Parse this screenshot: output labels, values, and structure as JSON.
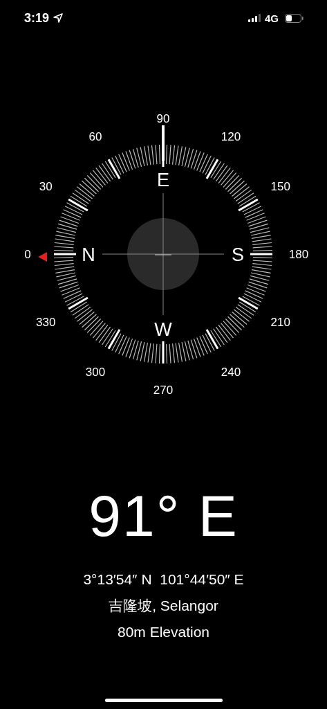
{
  "status_bar": {
    "time": "3:19",
    "network": "4G"
  },
  "dial": {
    "degree_labels": [
      "0",
      "30",
      "60",
      "90",
      "120",
      "150",
      "180",
      "210",
      "240",
      "270",
      "300",
      "330"
    ],
    "cardinals": [
      "N",
      "E",
      "S",
      "W"
    ]
  },
  "heading": "91° E",
  "coordinates": "3°13′54″ N  101°44′50″ E",
  "location": "吉隆坡, Selangor",
  "elevation": "80m Elevation"
}
